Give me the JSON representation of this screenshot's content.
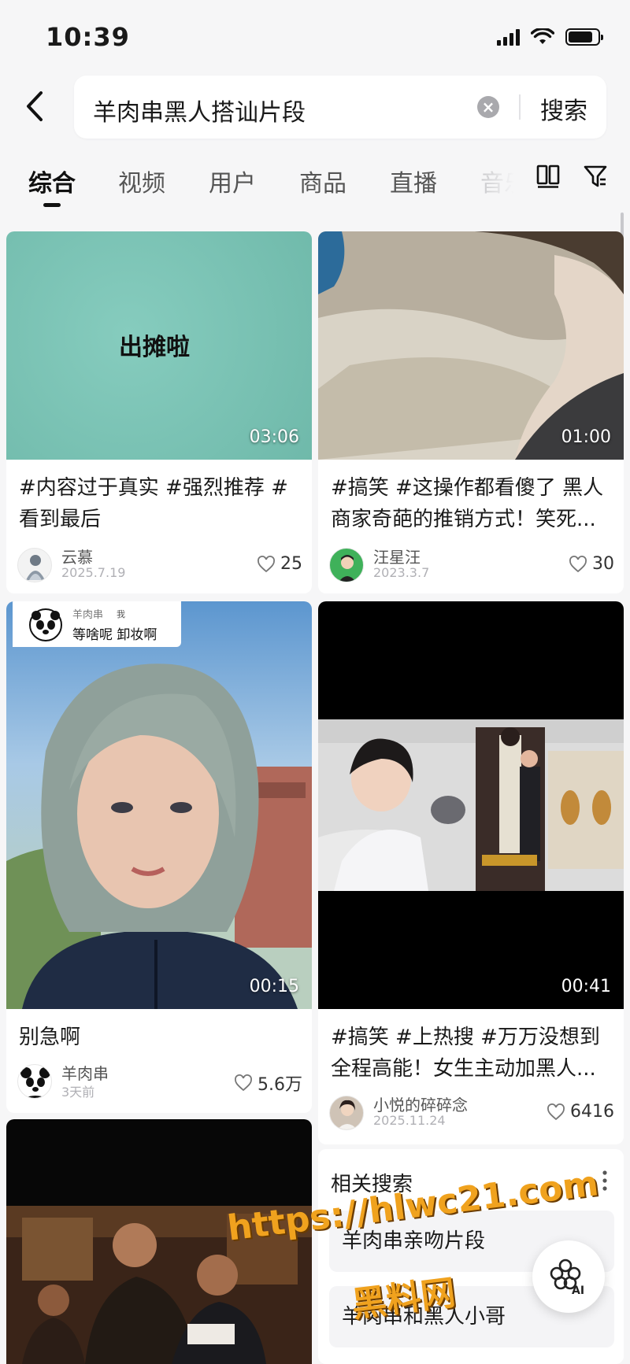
{
  "status_bar": {
    "time": "10:39"
  },
  "search": {
    "query": "羊肉串黑人搭讪片段",
    "submit_label": "搜索"
  },
  "tabs": [
    {
      "label": "综合",
      "active": true
    },
    {
      "label": "视频"
    },
    {
      "label": "用户"
    },
    {
      "label": "商品"
    },
    {
      "label": "直播"
    },
    {
      "label": "音乐"
    }
  ],
  "cards": [
    {
      "thumb_text": "出摊啦",
      "duration": "03:06",
      "title": "#内容过于真实 #强烈推荐 #看到最后",
      "author": "云慕",
      "date": "2025.7.19",
      "likes": "25"
    },
    {
      "duration": "01:00",
      "title": "#搞笑 #这操作都看傻了 黑人商家奇葩的推销方式！笑死...",
      "author": "汪星汪",
      "date": "2023.3.7",
      "likes": "30"
    },
    {
      "overlay_author": "羊肉串",
      "overlay_tag": "我",
      "overlay_caption": "等啥呢 卸妆啊",
      "duration": "00:15",
      "title": "别急啊",
      "author": "羊肉串",
      "date": "3天前",
      "likes": "5.6万"
    },
    {
      "duration": "00:41",
      "title": "#搞笑 #上热搜 #万万没想到 全程高能！女生主动加黑人...",
      "author": "小悦的碎碎念",
      "date": "2025.11.24",
      "likes": "6416"
    }
  ],
  "related": {
    "title": "相关搜索",
    "items": [
      "羊肉串亲吻片段",
      "羊肉串和黑人小哥"
    ]
  },
  "ai_fab_label": "AI",
  "watermark": {
    "url": "https://hlwc21.com",
    "name": "黑料网"
  },
  "colors": {
    "accent": "#111111",
    "watermark": "#f0a21e",
    "teal_thumb": "#7fc6b8"
  }
}
